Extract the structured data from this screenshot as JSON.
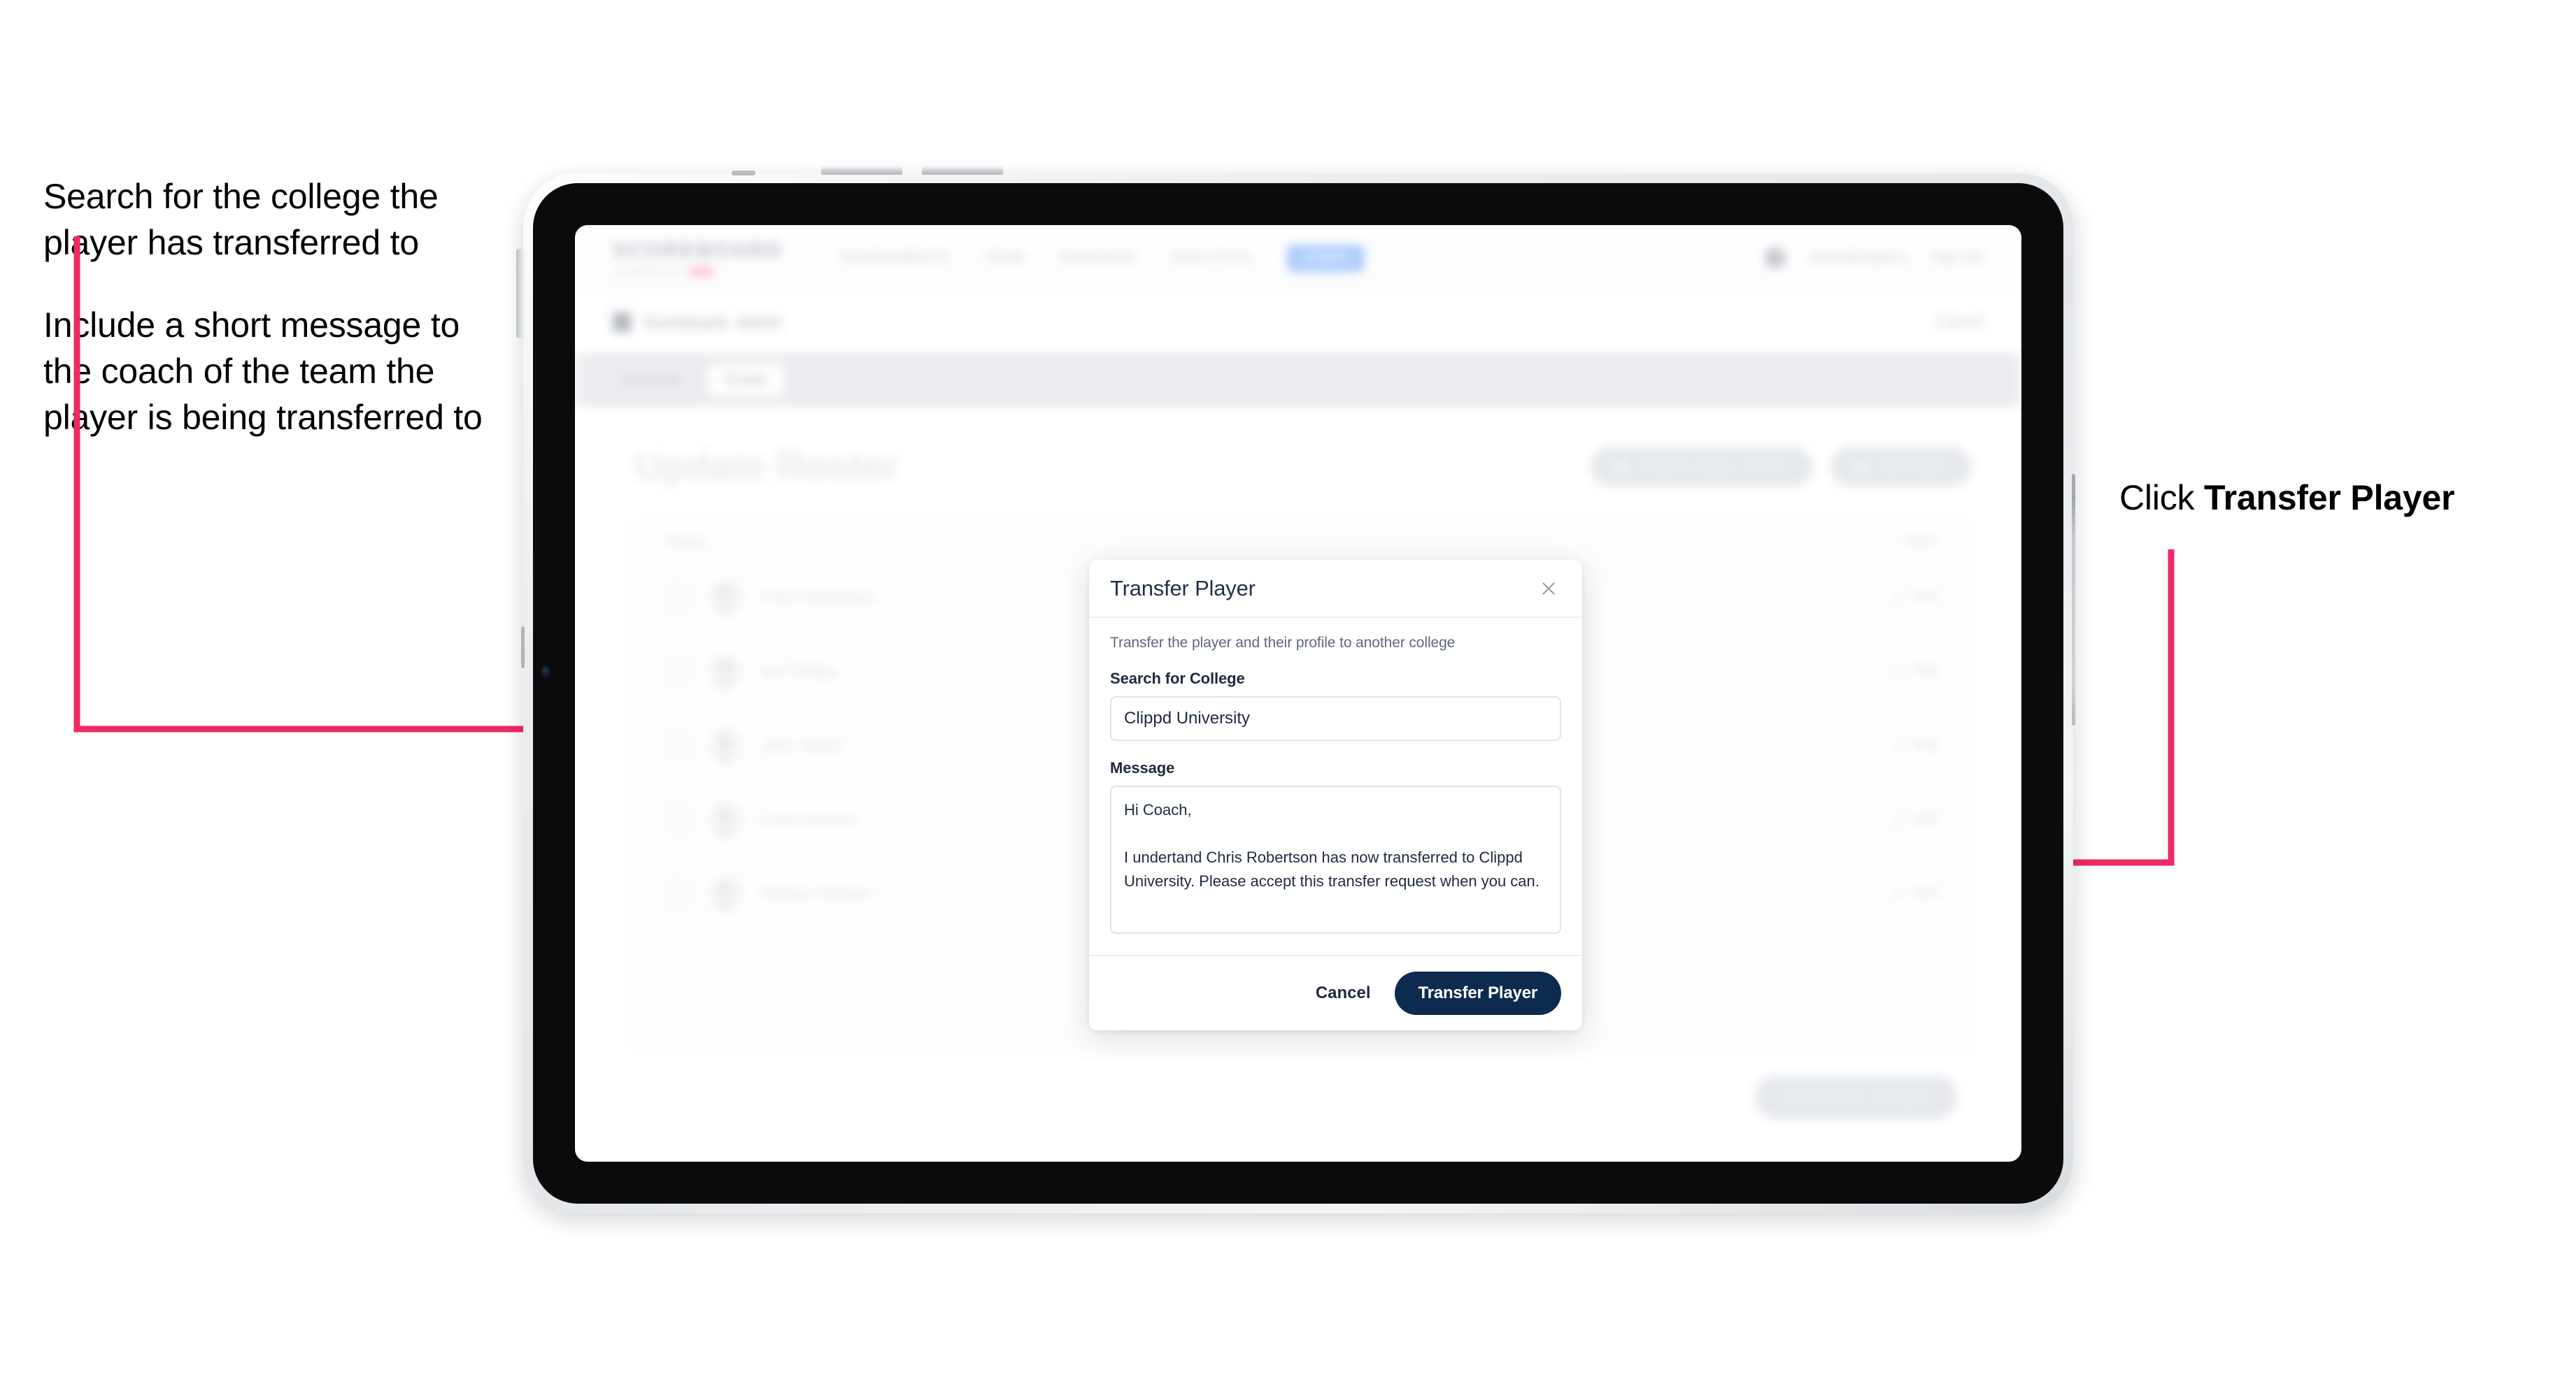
{
  "annotations": {
    "left": [
      "Search for the college the player has transferred to",
      "Include a short message to the coach of the team the player is being transferred to"
    ],
    "right_prefix": "Click ",
    "right_bold": "Transfer Player"
  },
  "colors": {
    "accent_pink": "#EE2A64",
    "primary_navy": "#0D2B4E",
    "nav_pill_blue": "#5B9CF8",
    "brand_pink": "#FF3F6E"
  },
  "app": {
    "brand": {
      "word": "SCOREBOARD",
      "sub": "POWERED BY",
      "sub_mark": "clippd"
    },
    "nav": [
      {
        "label": "TOURNAMENTS",
        "active": false
      },
      {
        "label": "TEAM",
        "active": false
      },
      {
        "label": "RANKINGS",
        "active": false
      },
      {
        "label": "ANALYTICS",
        "active": false
      },
      {
        "label": "ADMIN",
        "active": true
      }
    ],
    "top_right": {
      "user": "admin@clippd.io",
      "action": "Sign Out"
    },
    "breadcrumb": {
      "icon": "shield-icon",
      "text": "Scoreboard",
      "text_muted": "Admin",
      "right": "Cancel"
    },
    "tabs": [
      {
        "label": "Overview",
        "active": false
      },
      {
        "label": "Roster",
        "active": true
      }
    ],
    "page_title": "Update Roster",
    "page_actions": [
      {
        "label": "Request Player Transfer",
        "icon": "transfer-icon"
      },
      {
        "label": "Add Player",
        "icon": "plus-icon"
      }
    ],
    "roster": {
      "columns": [
        "Player",
        "EDIT"
      ],
      "rows": [
        {
          "name": "Chris Robertson",
          "edit": "Edit"
        },
        {
          "name": "Ian Phillips",
          "edit": "Edit"
        },
        {
          "name": "John Taylor",
          "edit": "Edit"
        },
        {
          "name": "Lewis Barnes",
          "edit": "Edit"
        },
        {
          "name": "Nathan Holmes",
          "edit": "Edit"
        }
      ]
    },
    "footer_button": "Save Roster Changes"
  },
  "modal": {
    "title": "Transfer Player",
    "close_icon": "close-icon",
    "description": "Transfer the player and their profile to another college",
    "college_label": "Search for College",
    "college_value": "Clippd University",
    "college_placeholder": "Search for College",
    "message_label": "Message",
    "message_value": "Hi Coach,\n\nI undertand Chris Robertson has now transferred to Clippd University. Please accept this transfer request when you can.",
    "message_placeholder": "Message",
    "cancel_label": "Cancel",
    "submit_label": "Transfer Player"
  }
}
